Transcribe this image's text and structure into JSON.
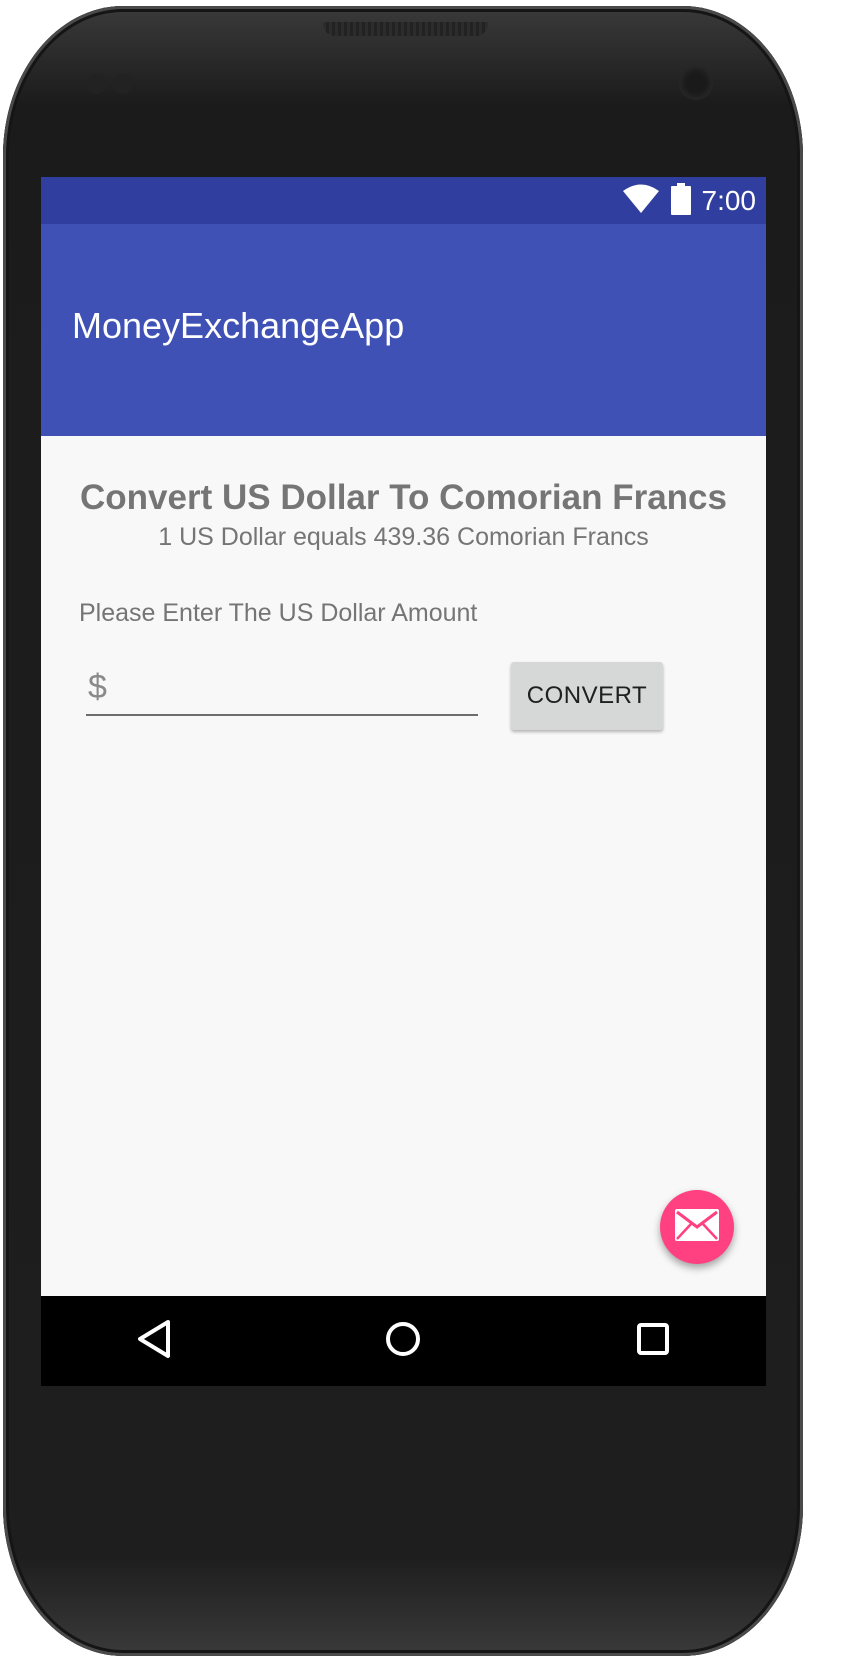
{
  "status_bar": {
    "time": "7:00",
    "icons": [
      "wifi-icon",
      "battery-icon"
    ]
  },
  "app_bar": {
    "title": "MoneyExchangeApp"
  },
  "main": {
    "heading": "Convert US Dollar To Comorian Francs",
    "rate_text": "1 US Dollar equals 439.36 Comorian Francs",
    "prompt": "Please Enter The US Dollar Amount",
    "amount_input": {
      "value": "",
      "placeholder": "$"
    },
    "convert_label": "CONVERT"
  },
  "fab": {
    "icon": "mail-icon"
  },
  "nav_bar": {
    "icons": [
      "back-icon",
      "home-icon",
      "recents-icon"
    ]
  },
  "colors": {
    "status_bar": "#303f9f",
    "app_bar": "#3f51b5",
    "background": "#f8f8f8",
    "fab": "#ff4081",
    "button": "#d6d7d7"
  }
}
